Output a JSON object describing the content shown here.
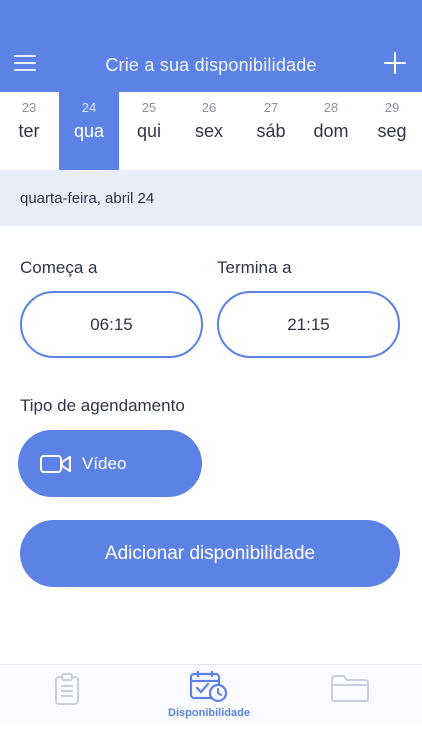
{
  "header": {
    "title": "Crie a sua disponibilidade",
    "menu_icon": "hamburger-menu-icon",
    "add_icon": "plus-icon"
  },
  "week": [
    {
      "num": "23",
      "day": "ter",
      "active": false
    },
    {
      "num": "24",
      "day": "qua",
      "active": true
    },
    {
      "num": "25",
      "day": "qui",
      "active": false
    },
    {
      "num": "26",
      "day": "sex",
      "active": false
    },
    {
      "num": "27",
      "day": "sáb",
      "active": false
    },
    {
      "num": "28",
      "day": "dom",
      "active": false
    },
    {
      "num": "29",
      "day": "seg",
      "active": false
    }
  ],
  "selected_date": "quarta-feira, abril 24",
  "start": {
    "label": "Começa a",
    "value": "06:15"
  },
  "end": {
    "label": "Termina a",
    "value": "21:15"
  },
  "appointment": {
    "label": "Tipo de agendamento",
    "type": "Vídeo",
    "icon": "video-camera-icon"
  },
  "action": {
    "label": "Adicionar disponibilidade"
  },
  "tabs": [
    {
      "icon": "clipboard-icon",
      "label": "",
      "active": false
    },
    {
      "icon": "calendar-clock-icon",
      "label": "Disponibilidade",
      "active": true
    },
    {
      "icon": "folder-icon",
      "label": "",
      "active": false
    }
  ],
  "colors": {
    "accent": "#5b82e4",
    "date_bar": "#e8edf8",
    "inactive_icon": "#c9cede"
  }
}
